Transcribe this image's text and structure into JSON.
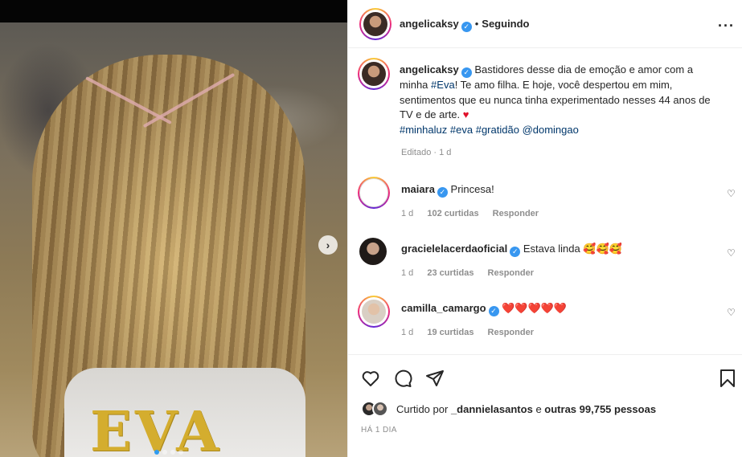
{
  "post": {
    "author": "angelicaksy",
    "follow_status": "Seguindo",
    "separator": "•",
    "more_icon": "more-horizontal-icon",
    "caption_text": "Bastidores desse dia de emoção e amor com a minha",
    "caption_tag_eva": "#Eva",
    "caption_text_2": "! Te amo filha. E hoje, você despertou em mim, sentimentos que eu nunca tinha experimentado nesses 44 anos de TV e de arte.",
    "caption_heart": "♥",
    "hashtags": [
      "#minhaluz",
      "#eva",
      "#gratidão",
      "@domingao"
    ],
    "edited_label": "Editado",
    "edited_sep": "·",
    "edited_time": "1 d",
    "image_text": "EVA",
    "carousel_count": 4,
    "carousel_active": 0
  },
  "comments": [
    {
      "user": "maiara",
      "text": "Princesa!",
      "time": "1 d",
      "likes": "102 curtidas",
      "reply": "Responder",
      "ring": true
    },
    {
      "user": "gracielelacerdaoficial",
      "text": "Estava linda 🥰🥰🥰",
      "time": "1 d",
      "likes": "23 curtidas",
      "reply": "Responder",
      "ring": false
    },
    {
      "user": "camilla_camargo",
      "text": "❤️❤️❤️❤️❤️",
      "time": "1 d",
      "likes": "19 curtidas",
      "reply": "Responder",
      "ring": true
    }
  ],
  "actions": {
    "like_icon": "heart-outline-icon",
    "comment_icon": "comment-bubble-icon",
    "share_icon": "paper-plane-icon",
    "save_icon": "bookmark-icon"
  },
  "likes": {
    "prefix": "Curtido por",
    "user": "_dannielasantos",
    "middle": "e",
    "others": "outras 99,755 pessoas"
  },
  "time_ago": "HÁ 1 DIA",
  "colors": {
    "link": "#00376b",
    "verified": "#3897f0",
    "heart": "#e0102a",
    "muted": "#8e8e8e"
  }
}
